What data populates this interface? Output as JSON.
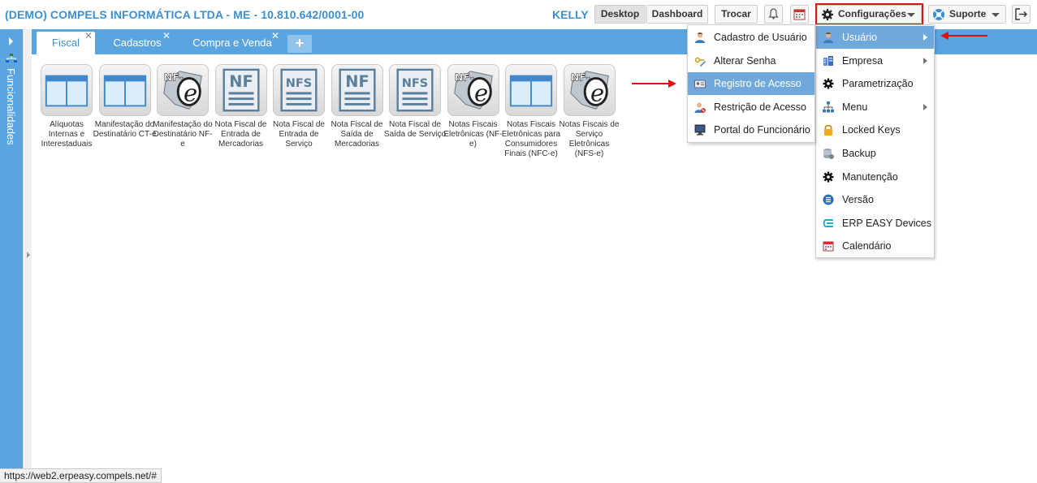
{
  "header": {
    "company": "(DEMO) COMPELS INFORMÁTICA LTDA - ME - 10.810.642/0001-00",
    "user": "KELLY",
    "desktop_label": "Desktop",
    "dashboard_label": "Dashboard",
    "trocar_label": "Trocar",
    "config_label": "Configurações",
    "suporte_label": "Suporte",
    "bell_icon": "bell-icon",
    "calendar_icon": "calendar-icon",
    "logout_icon": "logout-icon"
  },
  "rail": {
    "label": "Funcionalidades"
  },
  "tabs": [
    {
      "label": "Fiscal",
      "active": true
    },
    {
      "label": "Cadastros",
      "active": false
    },
    {
      "label": "Compra e Venda",
      "active": false
    }
  ],
  "tiles": [
    {
      "caption": "Alíquotas Internas e Interestaduais",
      "icon": "window-icon"
    },
    {
      "caption": "Manifestação do Destinatário CT-e",
      "icon": "window-icon"
    },
    {
      "caption": "Manifestação do Destinatário NF-e",
      "icon": "nfe-icon"
    },
    {
      "caption": "Nota Fiscal de Entrada de Mercadorias",
      "icon": "nf-doc-icon",
      "badge": "NF"
    },
    {
      "caption": "Nota Fiscal de Entrada de Serviço",
      "icon": "nfs-doc-icon",
      "badge": "NFS"
    },
    {
      "caption": "Nota Fiscal de Saída de Mercadorias",
      "icon": "nf-doc-icon",
      "badge": "NF"
    },
    {
      "caption": "Nota Fiscal de Saída de Serviço",
      "icon": "nfs-doc-icon",
      "badge": "NFS"
    },
    {
      "caption": "Notas Fiscais Eletrônicas (NF-e)",
      "icon": "nfe-icon"
    },
    {
      "caption": "Notas Fiscais Eletrônicas para Consumidores Finais (NFC-e)",
      "icon": "window-icon"
    },
    {
      "caption": "Notas Fiscais de Serviço Eletrônicas (NFS-e)",
      "icon": "nfe-icon"
    }
  ],
  "config_menu": [
    {
      "label": "Usuário",
      "icon": "user-icon",
      "submenu": true,
      "highlight": true
    },
    {
      "label": "Empresa",
      "icon": "building-icon",
      "submenu": true
    },
    {
      "label": "Parametrização",
      "icon": "gear-icon"
    },
    {
      "label": "Menu",
      "icon": "sitemap-icon",
      "submenu": true
    },
    {
      "label": "Locked Keys",
      "icon": "lock-icon"
    },
    {
      "label": "Backup",
      "icon": "database-icon"
    },
    {
      "label": "Manutenção",
      "icon": "gear-icon"
    },
    {
      "label": "Versão",
      "icon": "list-icon"
    },
    {
      "label": "ERP EASY Devices",
      "icon": "devices-icon"
    },
    {
      "label": "Calendário",
      "icon": "calendar-icon"
    }
  ],
  "user_submenu": [
    {
      "label": "Cadastro de Usuário",
      "icon": "user-icon"
    },
    {
      "label": "Alterar Senha",
      "icon": "key-edit-icon"
    },
    {
      "label": "Registro de Acesso",
      "icon": "id-card-icon",
      "highlight": true
    },
    {
      "label": "Restrição de Acesso",
      "icon": "user-block-icon"
    },
    {
      "label": "Portal do Funcionário",
      "icon": "monitor-icon"
    }
  ],
  "status_url": "https://web2.erpeasy.compels.net/#",
  "colors": {
    "accent": "#5aa4e0",
    "title": "#3b8fd4",
    "highlight": "#6fa8dc",
    "annotation": "#e01010"
  }
}
